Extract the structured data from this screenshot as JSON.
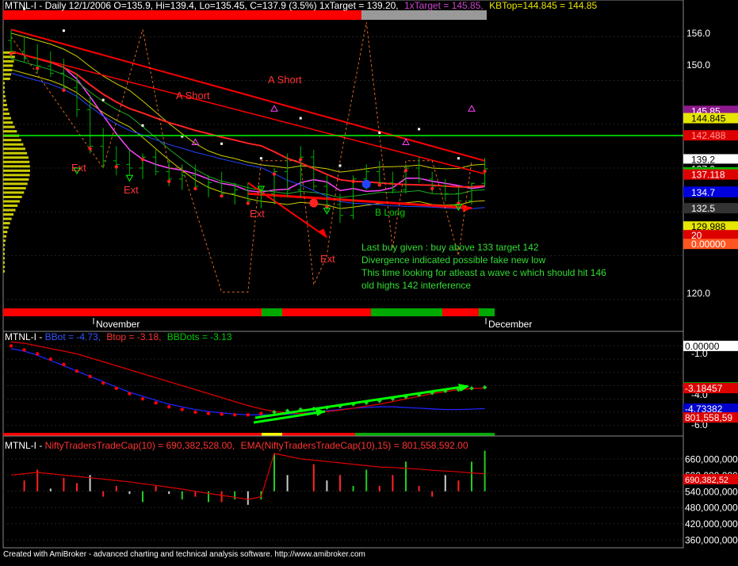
{
  "price_pane": {
    "header": {
      "prefix": "MTNL-I - Daily 12/1/2006 O=135.9, Hi=139.4, Lo=135.45, C=137.9 (3.5%) 1xTarget = 139.20,",
      "target_label": "1xTarget = 145.85,",
      "kbtop_label": "KBTop=144.845 = 144.85"
    },
    "axis_ticks": [
      "156.0",
      "150.0",
      "120.0"
    ],
    "price_tags": [
      {
        "value": 145.85,
        "label": "145.85",
        "bg": "#8e1a8e",
        "fg": "#ffffff"
      },
      {
        "value": 144.845,
        "label": "144.845",
        "bg": "#e6e600",
        "fg": "#000000"
      },
      {
        "value": 142.488,
        "label": "142.488",
        "bg": "#dd0000",
        "fg": "#ff9999"
      },
      {
        "value": 139.2,
        "label": "139.2",
        "bg": "#ffffff",
        "fg": "#000000"
      },
      {
        "value": 137.9,
        "label": "137.9",
        "bg": "#000000",
        "fg": "#ffffff"
      },
      {
        "value": 137.417,
        "label": "137.417",
        "bg": "#00bb00",
        "fg": "#ffffff"
      },
      {
        "value": 137.118,
        "label": "137.118",
        "bg": "#dd0000",
        "fg": "#ffffff"
      },
      {
        "value": 134.77,
        "label": "134.77",
        "bg": "#0000dd",
        "fg": "#ffffff"
      },
      {
        "value": 134.7,
        "label": "134.7",
        "bg": "#0000dd",
        "fg": "#ffffff"
      },
      {
        "value": 132.5,
        "label": "132.5",
        "bg": "#333333",
        "fg": "#ffffff"
      },
      {
        "value": 129.988,
        "label": "129.988",
        "bg": "#e6e600",
        "fg": "#000000"
      },
      {
        "value": 128.8,
        "label": "20",
        "bg": "#dd0000",
        "fg": "#ffffff"
      },
      {
        "value": 127.6,
        "label": "0.00000",
        "bg": "#ff5522",
        "fg": "#ffffff"
      }
    ],
    "annotations": [
      "A Short",
      "A Short",
      "Ext",
      "Ext",
      "Ext",
      "Ext",
      "B Long"
    ],
    "comments": [
      "Last buy given : buy above 133 target 142",
      "Divergence indicated possible fake new low",
      "This time looking for atleast a wave c which should hit 146",
      "old highs 142 interference"
    ],
    "date_labels": [
      "November",
      "December"
    ]
  },
  "bb_pane": {
    "header": {
      "prefix": "MTNL-I - ",
      "bbot": "BBot = -4.73,",
      "btop": "Btop = -3.18,",
      "bbdots": "BBDots = -3.13"
    },
    "axis_ticks": [
      "-1.0",
      "-4.0",
      "-6.0"
    ],
    "tags": [
      {
        "value": 0.0,
        "label": "0.00000",
        "bg": "#ffffff",
        "fg": "#000000"
      },
      {
        "value": -3.12891,
        "label": "-3.12891",
        "bg": "#00aa00",
        "fg": "#ffffff"
      },
      {
        "value": -3.18457,
        "label": "-3.18457",
        "bg": "#dd0000",
        "fg": "#ffffff"
      },
      {
        "value": -4.73382,
        "label": "-4.73382",
        "bg": "#0000cc",
        "fg": "#ffffff"
      },
      {
        "value": -5.4,
        "label": "801,558,59",
        "bg": "#dd0000",
        "fg": "#ffffff"
      }
    ]
  },
  "volume_pane": {
    "header": {
      "prefix": "MTNL-I - ",
      "series1": "NiftyTradersTradeCap(10) = 690,382,528.00,",
      "series2": "EMA(NiftyTradersTradeCap(10),15) = 801,558,592.00"
    },
    "axis_ticks": [
      "660,000,000",
      "600,000,000",
      "540,000,000",
      "480,000,000",
      "420,000,000",
      "360,000,000"
    ],
    "tag": {
      "label": "690,382,52",
      "bg": "#dd0000",
      "fg": "#ffffff"
    }
  },
  "footer": "Created with AmiBroker - advanced charting and technical analysis software. http://www.amibroker.com",
  "colors": {
    "background": "#000000",
    "bullish": "#00aa00",
    "bearish": "#dd0000",
    "comment_text": "#33dd33",
    "close_line": "#00ff00"
  },
  "chart_data": [
    {
      "type": "candlestick",
      "title": "MTNL-I - Daily 12/1/2006",
      "ohlc_last": {
        "open": 135.9,
        "high": 139.4,
        "low": 135.45,
        "close": 137.9,
        "change_pct": 3.5
      },
      "ylim": [
        118,
        158
      ],
      "candles": [
        {
          "o": 155.5,
          "h": 157.0,
          "l": 153.0,
          "c": 154.0
        },
        {
          "o": 154.0,
          "h": 156.0,
          "l": 152.5,
          "c": 153.0
        },
        {
          "o": 153.0,
          "h": 155.0,
          "l": 151.0,
          "c": 152.0
        },
        {
          "o": 152.0,
          "h": 154.0,
          "l": 150.5,
          "c": 151.0
        },
        {
          "o": 151.0,
          "h": 153.0,
          "l": 148.5,
          "c": 149.0
        },
        {
          "o": 149.0,
          "h": 151.0,
          "l": 145.0,
          "c": 146.0
        },
        {
          "o": 146.0,
          "h": 148.0,
          "l": 140.0,
          "c": 141.0
        },
        {
          "o": 141.0,
          "h": 143.5,
          "l": 138.0,
          "c": 139.0
        },
        {
          "o": 139.0,
          "h": 141.0,
          "l": 137.0,
          "c": 138.5
        },
        {
          "o": 138.5,
          "h": 140.5,
          "l": 137.0,
          "c": 138.0
        },
        {
          "o": 138.0,
          "h": 140.0,
          "l": 136.5,
          "c": 139.5
        },
        {
          "o": 139.5,
          "h": 140.5,
          "l": 137.0,
          "c": 137.5
        },
        {
          "o": 137.5,
          "h": 139.0,
          "l": 135.5,
          "c": 136.5
        },
        {
          "o": 136.5,
          "h": 138.5,
          "l": 135.0,
          "c": 137.0
        },
        {
          "o": 137.0,
          "h": 138.5,
          "l": 135.0,
          "c": 135.5
        },
        {
          "o": 135.5,
          "h": 137.0,
          "l": 134.0,
          "c": 136.0
        },
        {
          "o": 136.0,
          "h": 137.5,
          "l": 134.0,
          "c": 134.5
        },
        {
          "o": 134.5,
          "h": 136.0,
          "l": 133.0,
          "c": 135.0
        },
        {
          "o": 135.0,
          "h": 136.0,
          "l": 133.0,
          "c": 133.5
        },
        {
          "o": 133.5,
          "h": 135.5,
          "l": 132.5,
          "c": 134.5
        },
        {
          "o": 134.5,
          "h": 138.0,
          "l": 133.0,
          "c": 137.5
        },
        {
          "o": 137.5,
          "h": 140.0,
          "l": 134.0,
          "c": 135.0
        },
        {
          "o": 135.0,
          "h": 141.0,
          "l": 134.0,
          "c": 139.5
        },
        {
          "o": 139.5,
          "h": 140.5,
          "l": 135.0,
          "c": 135.5
        },
        {
          "o": 135.5,
          "h": 137.0,
          "l": 132.0,
          "c": 133.0
        },
        {
          "o": 133.0,
          "h": 134.5,
          "l": 130.5,
          "c": 131.5
        },
        {
          "o": 131.5,
          "h": 137.0,
          "l": 131.0,
          "c": 136.5
        },
        {
          "o": 136.5,
          "h": 138.5,
          "l": 135.0,
          "c": 137.5
        },
        {
          "o": 137.5,
          "h": 139.0,
          "l": 135.5,
          "c": 136.0
        },
        {
          "o": 136.0,
          "h": 137.5,
          "l": 134.5,
          "c": 135.0
        },
        {
          "o": 135.0,
          "h": 138.5,
          "l": 134.5,
          "c": 138.0
        },
        {
          "o": 138.0,
          "h": 139.5,
          "l": 136.0,
          "c": 136.5
        },
        {
          "o": 136.5,
          "h": 137.5,
          "l": 134.5,
          "c": 135.5
        },
        {
          "o": 135.5,
          "h": 136.5,
          "l": 133.5,
          "c": 134.5
        },
        {
          "o": 134.5,
          "h": 135.5,
          "l": 132.5,
          "c": 133.5
        },
        {
          "o": 133.5,
          "h": 136.0,
          "l": 133.0,
          "c": 135.9
        },
        {
          "o": 135.9,
          "h": 139.4,
          "l": 135.45,
          "c": 137.9
        }
      ]
    },
    {
      "type": "line",
      "title": "BBot / Btop / BBDots",
      "ylim": [
        -6.5,
        0.5
      ],
      "series": [
        {
          "name": "BBot",
          "color": "#2222ff",
          "values": [
            -0.2,
            -0.4,
            -0.7,
            -1.1,
            -1.5,
            -1.9,
            -2.3,
            -2.7,
            -3.1,
            -3.5,
            -3.8,
            -4.1,
            -4.4,
            -4.6,
            -4.8,
            -4.95,
            -5.05,
            -5.15,
            -5.2,
            -5.2,
            -5.2,
            -5.15,
            -5.1,
            -5.0,
            -4.9,
            -4.8,
            -4.7,
            -4.65,
            -4.6,
            -4.6,
            -4.65,
            -4.7,
            -4.75,
            -4.8,
            -4.8,
            -4.77,
            -4.73
          ]
        },
        {
          "name": "Btop",
          "color": "#dd0000",
          "values": [
            0.3,
            0.2,
            0.0,
            -0.2,
            -0.4,
            -0.6,
            -0.9,
            -1.2,
            -1.5,
            -1.8,
            -2.1,
            -2.4,
            -2.7,
            -3.0,
            -3.3,
            -3.6,
            -3.9,
            -4.2,
            -4.5,
            -4.75,
            -4.95,
            -5.05,
            -5.1,
            -5.05,
            -4.95,
            -4.85,
            -4.7,
            -4.55,
            -4.4,
            -4.2,
            -4.0,
            -3.8,
            -3.6,
            -3.45,
            -3.3,
            -3.22,
            -3.18
          ]
        },
        {
          "name": "BBDots",
          "color": "#ff0000",
          "values": [
            0.0,
            -0.3,
            -0.6,
            -1.0,
            -1.4,
            -1.9,
            -2.3,
            -2.8,
            -3.2,
            -3.6,
            -4.0,
            -4.3,
            -4.6,
            -4.8,
            -5.0,
            -5.1,
            -5.15,
            -5.2,
            -5.2,
            -5.1,
            -5.0,
            -4.9,
            -4.8,
            -4.75,
            -4.65,
            -4.55,
            -4.4,
            -4.3,
            -4.15,
            -4.0,
            -3.85,
            -3.7,
            -3.55,
            -3.4,
            -3.3,
            -3.2,
            -3.13
          ]
        }
      ]
    },
    {
      "type": "bar",
      "title": "NiftyTradersTradeCap(10)",
      "ylim": [
        340000000,
        680000000
      ],
      "series": [
        {
          "name": "NiftyTradersTradeCap(10)",
          "values": [
            540000000,
            580000000,
            620000000,
            550000000,
            590000000,
            570000000,
            600000000,
            520000000,
            560000000,
            530000000,
            500000000,
            560000000,
            530000000,
            510000000,
            520000000,
            500000000,
            500000000,
            510000000,
            490000000,
            510000000,
            680000000,
            600000000,
            540000000,
            640000000,
            580000000,
            600000000,
            560000000,
            620000000,
            560000000,
            600000000,
            650000000,
            560000000,
            520000000,
            600000000,
            580000000,
            650000000,
            690382528
          ]
        },
        {
          "name": "EMA(NiftyTradersTradeCap(10),15)",
          "color": "#dd0000",
          "values": [
            600000000,
            605000000,
            610000000,
            605000000,
            600000000,
            595000000,
            590000000,
            585000000,
            580000000,
            575000000,
            568000000,
            562000000,
            555000000,
            548000000,
            540000000,
            532000000,
            525000000,
            518000000,
            510000000,
            520000000,
            680000000,
            670000000,
            660000000,
            655000000,
            650000000,
            645000000,
            640000000,
            635000000,
            630000000,
            628000000,
            625000000,
            622000000,
            618000000,
            615000000,
            612000000,
            608000000,
            605000000
          ]
        }
      ]
    }
  ]
}
